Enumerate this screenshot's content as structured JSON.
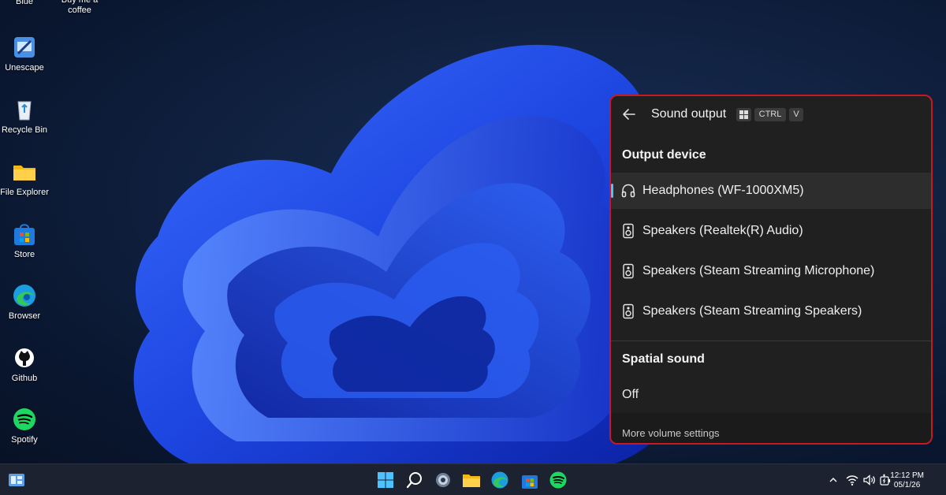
{
  "desktop": {
    "icons": [
      {
        "label": "Blue",
        "icon": "blue-folder-icon"
      },
      {
        "label": "Buy me a coffee",
        "icon": "coffee-icon"
      },
      {
        "label": "Unescape",
        "icon": "unescape-app-icon"
      },
      {
        "label": "Recycle Bin",
        "icon": "recycle-bin-icon"
      },
      {
        "label": "File Explorer",
        "icon": "folder-icon"
      },
      {
        "label": "Store",
        "icon": "store-icon"
      },
      {
        "label": "Browser",
        "icon": "edge-icon"
      },
      {
        "label": "Github",
        "icon": "github-icon"
      },
      {
        "label": "Spotify",
        "icon": "spotify-icon"
      }
    ]
  },
  "flyout": {
    "title": "Sound output",
    "shortcut": {
      "key1": "CTRL",
      "key2": "V",
      "win_icon": "windows-key-icon"
    },
    "output_device_heading": "Output device",
    "devices": [
      {
        "label": "Headphones (WF-1000XM5)",
        "icon": "headphones-icon",
        "selected": true
      },
      {
        "label": "Speakers (Realtek(R) Audio)",
        "icon": "speaker-icon",
        "selected": false
      },
      {
        "label": "Speakers (Steam Streaming Microphone)",
        "icon": "speaker-icon",
        "selected": false
      },
      {
        "label": "Speakers (Steam Streaming Speakers)",
        "icon": "speaker-icon",
        "selected": false
      }
    ],
    "spatial_heading": "Spatial sound",
    "spatial_value": "Off",
    "footer_link": "More volume settings",
    "accent_color": "#4cc2ff",
    "highlight_border": "#c61a22"
  },
  "taskbar": {
    "apps": [
      "widgets-icon",
      "start-icon",
      "search-icon",
      "settings-icon",
      "file-explorer-icon",
      "edge-icon",
      "store-icon",
      "spotify-icon"
    ],
    "tray": [
      "chevron-up-icon",
      "wifi-icon",
      "volume-icon",
      "battery-icon"
    ],
    "time": "12:12 PM",
    "date": "05/1/26"
  }
}
